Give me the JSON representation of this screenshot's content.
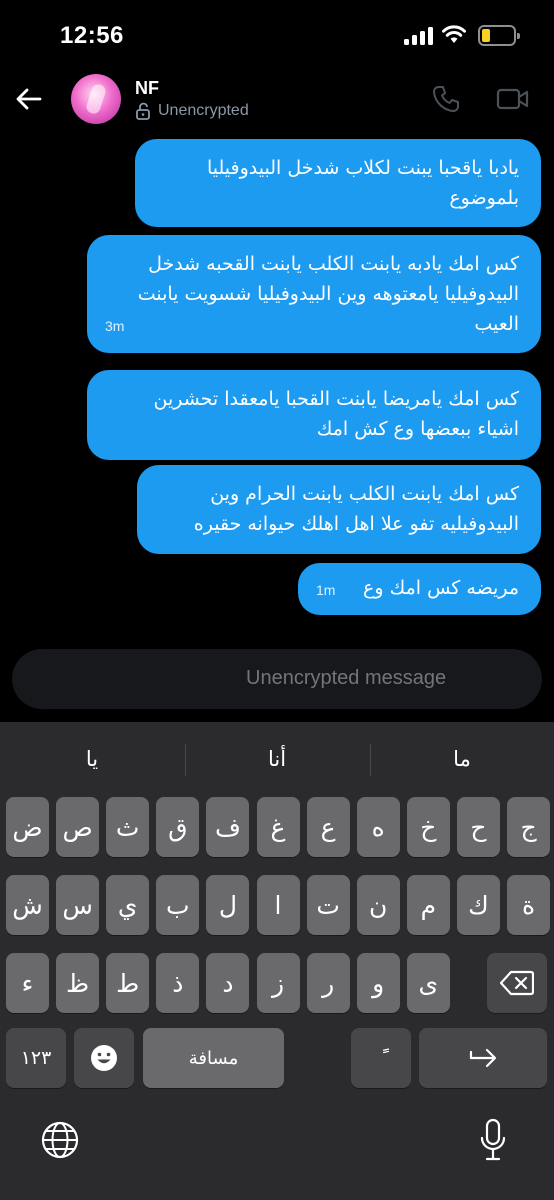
{
  "status_bar": {
    "time": "12:56"
  },
  "header": {
    "name": "NF",
    "encryption": "Unencrypted"
  },
  "messages": [
    {
      "text": "يادبا ياقحبا يبنت لكلاب شدخل البيدوفيليا بلموضوع",
      "time": ""
    },
    {
      "text": "كس امك يادبه يابنت الكلب يابنت القحبه شدخل البيدوفيليا يامعتوهه وين البيدوفيليا شسويت يابنت العيب",
      "time": "3m"
    },
    {
      "text": "كس امك يامريضا يابنت القحبا يامعقدا تحشرين اشياء ببعضها وع كش امك",
      "time": ""
    },
    {
      "text": "كس امك يابنت الكلب يابنت الحرام وين البيدوفيليه تفو علا اهل اهلك حيوانه حقيره",
      "time": ""
    },
    {
      "text": "مريضه كس امك وع",
      "time": "1m"
    }
  ],
  "composer": {
    "placeholder": "Unencrypted message"
  },
  "keyboard": {
    "suggestions": [
      "يا",
      "أنا",
      "ما"
    ],
    "row1": [
      "ض",
      "ص",
      "ث",
      "ق",
      "ف",
      "غ",
      "ع",
      "ه",
      "خ",
      "ح",
      "ج"
    ],
    "row2": [
      "ش",
      "س",
      "ي",
      "ب",
      "ل",
      "ا",
      "ت",
      "ن",
      "م",
      "ك",
      "ة"
    ],
    "row3": [
      "ء",
      "ظ",
      "ط",
      "ذ",
      "د",
      "ز",
      "ر",
      "و",
      "ى"
    ],
    "numbers_label": "١٢٣",
    "space_label": "مسافة",
    "diacritic_label": "ًً"
  }
}
